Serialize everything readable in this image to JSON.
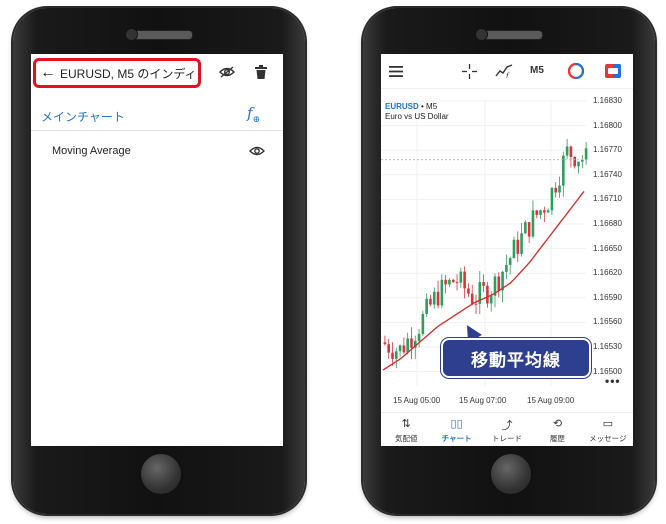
{
  "left": {
    "title": "EURUSD, M5 のインディ…",
    "section_label": "メインチャート",
    "add_indicator_icon": "f-plus-icon",
    "indicator": "Moving Average",
    "highlight_color": "#e0141e",
    "accent_color": "#2273d3"
  },
  "right": {
    "timeframe": "M5",
    "symbol": "EURUSD",
    "timeframe_suffix": " • M5",
    "description": "Euro vs US Dollar",
    "callout": "移動平均線",
    "y_ticks": [
      "1.16830",
      "1.16800",
      "1.16770",
      "1.16740",
      "1.16710",
      "1.16680",
      "1.16650",
      "1.16620",
      "1.16590",
      "1.16560",
      "1.16530",
      "1.16500"
    ],
    "x_ticks": [
      "15 Aug 05:00",
      "15 Aug 07:00",
      "15 Aug 09:00"
    ],
    "nav": [
      {
        "label": "気配値",
        "icon": "quotes-icon"
      },
      {
        "label": "チャート",
        "icon": "chart-icon",
        "active": true
      },
      {
        "label": "トレード",
        "icon": "trade-icon"
      },
      {
        "label": "履歴",
        "icon": "history-icon"
      },
      {
        "label": "メッセージ",
        "icon": "messages-icon"
      }
    ],
    "chart_data": {
      "type": "line",
      "title": "EURUSD • M5",
      "subtitle": "Euro vs US Dollar",
      "x": [
        "15 Aug 05:00",
        "15 Aug 07:00",
        "15 Aug 09:00"
      ],
      "ylim": [
        1.16485,
        1.16845
      ],
      "series": [
        {
          "name": "Moving Average",
          "values": [
            1.16505,
            1.1652,
            1.1654,
            1.1656,
            1.16575,
            1.1659,
            1.166,
            1.16615,
            1.1664,
            1.1667,
            1.167,
            1.1673
          ]
        },
        {
          "values": [
            1.1654,
            1.1653,
            1.1656,
            1.166,
            1.1662,
            1.16595,
            1.1661,
            1.1665,
            1.1669,
            1.1672,
            1.1678,
            1.1677
          ]
        }
      ],
      "up_color": "#2e9e5b",
      "down_color": "#d9343b",
      "ma_color": "#d42a2a"
    }
  }
}
